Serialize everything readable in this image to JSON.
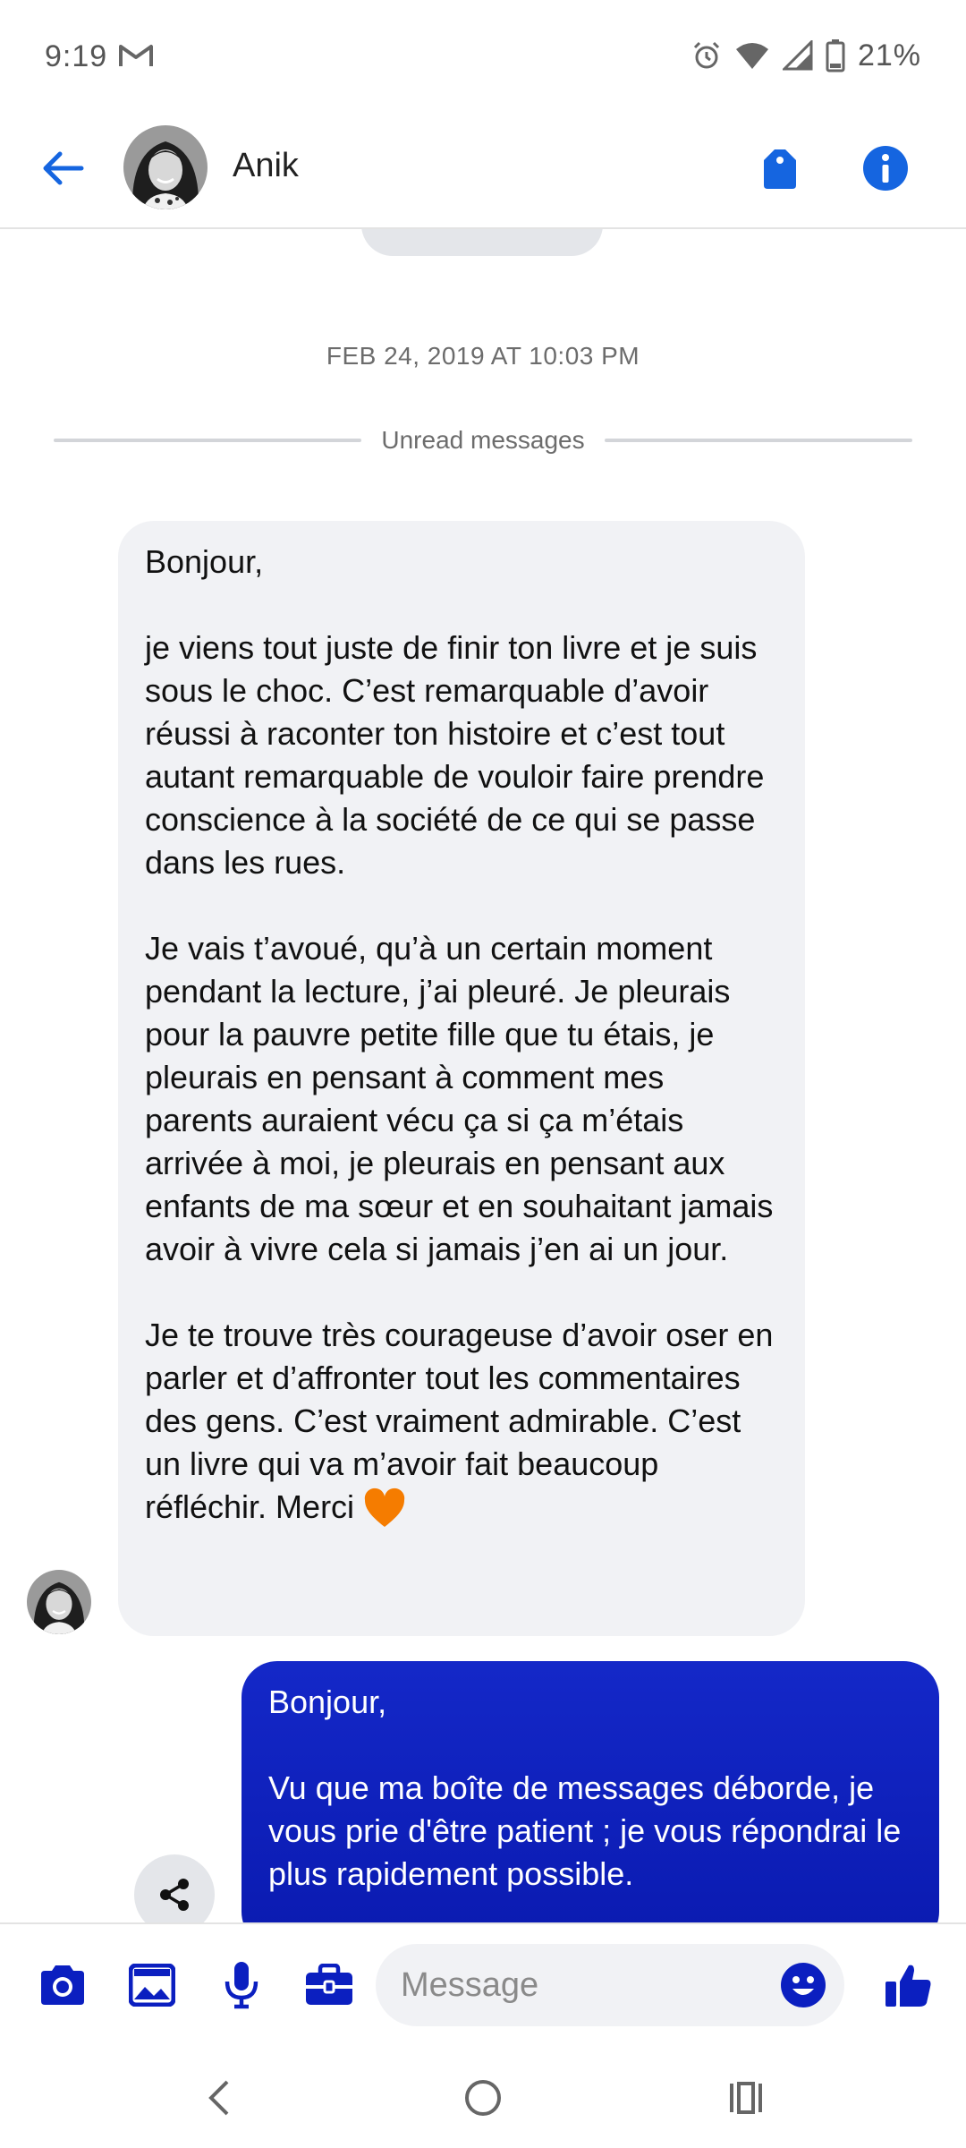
{
  "status": {
    "time": "9:19",
    "battery": "21%"
  },
  "header": {
    "contact_name": "Anik"
  },
  "conversation": {
    "date_separator": "FEB 24, 2019 AT 10:03 PM",
    "unread_label": "Unread messages",
    "incoming": {
      "p1": "Bonjour,",
      "p2": "je viens tout juste de finir ton livre et je suis sous le choc. C’est remarquable d’avoir réussi à raconter ton histoire et c’est tout autant remarquable de vouloir faire prendre conscience à la société de ce qui se passe dans les rues.",
      "p3": "Je vais t’avoué, qu’à un certain moment pendant la lecture, j’ai pleuré. Je pleurais pour la pauvre petite fille que tu étais, je pleurais en pensant à comment mes parents auraient vécu ça si ça m’étais arrivée à moi, je pleurais en pensant aux enfants de ma sœur et en souhaitant jamais avoir à vivre cela si jamais j’en ai un jour.",
      "p4": "Je te trouve très courageuse d’avoir oser en parler et d’affronter tout les commentaires des gens. C’est vraiment admirable. C’est un livre qui va m’avoir fait beaucoup réfléchir. Merci"
    },
    "outgoing": {
      "p1": "Bonjour,",
      "p2": "Vu que ma boîte de messages déborde, je vous prie d'être patient ; je vous répondrai le plus rapidement possible."
    }
  },
  "composer": {
    "placeholder": "Message"
  },
  "colors": {
    "accent": "#0b1fc0",
    "header_icons": "#1565e0",
    "heart": "#f57c00"
  },
  "icons": [
    "back-arrow-icon",
    "tag-icon",
    "info-icon",
    "camera-icon",
    "image-icon",
    "microphone-icon",
    "briefcase-icon",
    "emoji-icon",
    "thumbs-up-icon",
    "share-icon",
    "nav-back-icon",
    "nav-home-icon",
    "nav-recents-icon"
  ]
}
